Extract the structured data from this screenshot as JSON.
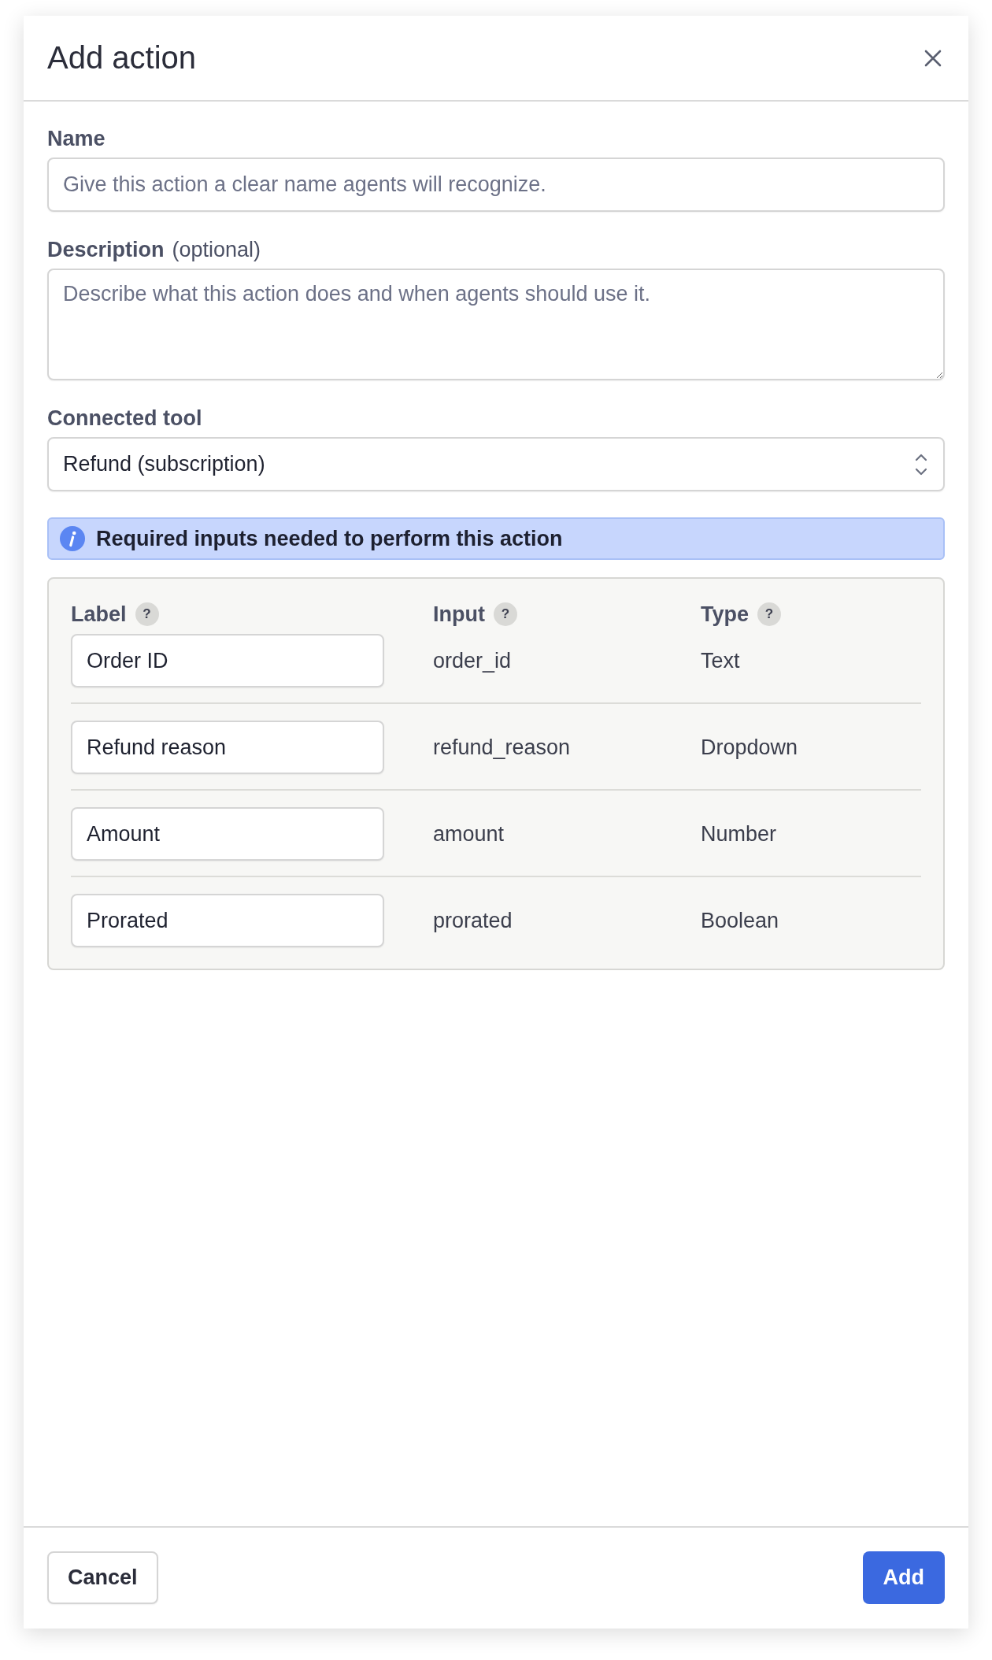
{
  "dialog": {
    "title": "Add action"
  },
  "fields": [
    {
      "kind": "text",
      "label": "Name",
      "placeholder": "Give this action a clear name agents will recognize."
    },
    {
      "kind": "textarea",
      "label": "Description",
      "note": "(optional)",
      "placeholder": "Describe what this action does and when agents should use it."
    },
    {
      "kind": "select",
      "label": "Connected tool",
      "value": "Refund (subscription)"
    }
  ],
  "notice": {
    "text": "Required inputs needed to perform this action"
  },
  "inputs_table": {
    "columns": [
      {
        "label": "Label",
        "help": "?"
      },
      {
        "label": "Input",
        "help": "?"
      },
      {
        "label": "Type",
        "help": "?"
      }
    ],
    "rows": [
      {
        "label": "Order ID",
        "input": "order_id",
        "type": "Text"
      },
      {
        "label": "Refund reason",
        "input": "refund_reason",
        "type": "Dropdown"
      },
      {
        "label": "Amount",
        "input": "amount",
        "type": "Number"
      },
      {
        "label": "Prorated",
        "input": "prorated",
        "type": "Boolean"
      }
    ]
  },
  "buttons": [
    {
      "kind": "secondary",
      "label": "Cancel"
    },
    {
      "kind": "primary",
      "label": "Add"
    }
  ]
}
